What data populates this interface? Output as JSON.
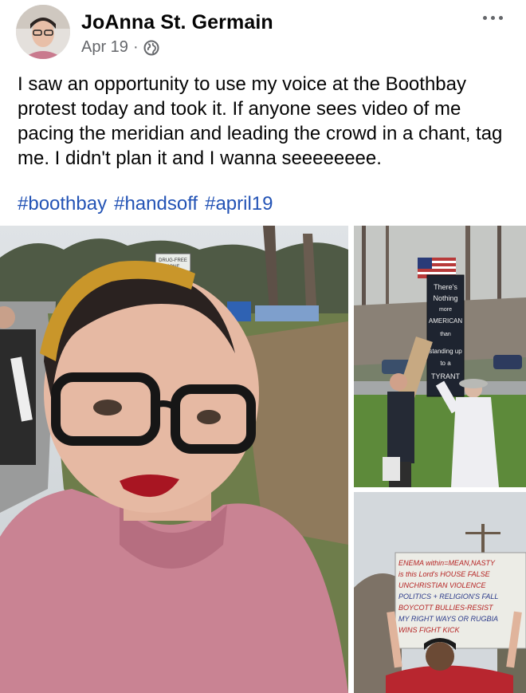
{
  "post": {
    "author": "JoAnna St. Germain",
    "date": "Apr 19",
    "separator": "·",
    "audience_icon": "globe-icon",
    "more_icon": "more-options-icon",
    "text": "I saw an opportunity to use my voice at the Boothbay protest today and took it. If anyone sees video of me pacing the meridian and leading the crowd in a chant, tag me. I didn't plan it and I wanna seeeeeeee.",
    "hashtags": [
      "#boothbay",
      "#handsoff",
      "#april19"
    ]
  },
  "photos": {
    "main": {
      "sign_text": [
        "DRUG-FREE",
        "ZONE"
      ]
    },
    "top_right": {
      "sign_text": [
        "There's",
        "Nothing",
        "more",
        "AMERICAN",
        "than",
        "standing up",
        "to a",
        "TYRANT"
      ]
    },
    "bottom_right": {
      "sign_text": [
        "ENEMA within=MEAN,NASTY",
        "is this Lord's HOUSE FALSE",
        "UNCHRISTIAN VIOLENCE",
        "POLITICS + RELIGION'S FALL",
        "BOYCOTT BULLIES-RESIST",
        "MY RIGHT WAYS OR RUGBIA",
        "WINS FIGHT KICK"
      ]
    }
  },
  "colors": {
    "text": "#050505",
    "secondary": "#65676b",
    "hashtag": "#2353b5"
  }
}
